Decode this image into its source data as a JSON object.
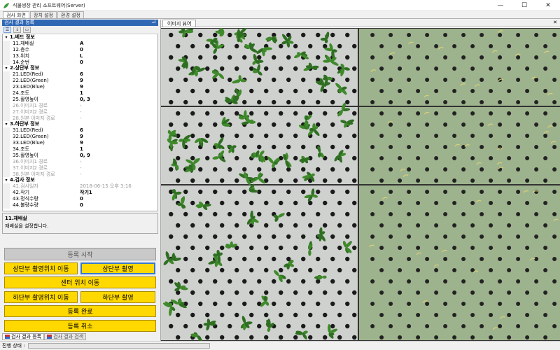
{
  "window": {
    "title": "식물생장 관리 소프트웨어(Server)"
  },
  "top_tabs": [
    "검사 화면",
    "장치 설정",
    "환경 설정"
  ],
  "left_panel": {
    "header": "검사 결과 등록",
    "categories": [
      {
        "title": "1.베드 정보",
        "rows": [
          {
            "name": "11.재배실",
            "value": "A"
          },
          {
            "name": "12.층수",
            "value": "0"
          },
          {
            "name": "13.위치",
            "value": "L"
          },
          {
            "name": "14.순번",
            "value": "0"
          }
        ]
      },
      {
        "title": "2.상단부 정보",
        "rows": [
          {
            "name": "21.LED(Red)",
            "value": "6"
          },
          {
            "name": "22.LED(Green)",
            "value": "9"
          },
          {
            "name": "23.LED(Blue)",
            "value": "9"
          },
          {
            "name": "24.조도",
            "value": "1"
          },
          {
            "name": "25.촬영높이",
            "value": "0, 3"
          },
          {
            "name": "26.이미지1 경로",
            "value": "-",
            "disabled": true
          },
          {
            "name": "27.이미지2 경로",
            "value": "-",
            "disabled": true
          },
          {
            "name": "28.원본 이미지 경로",
            "value": "-",
            "disabled": true
          }
        ]
      },
      {
        "title": "3.하단부 정보",
        "rows": [
          {
            "name": "31.LED(Red)",
            "value": "6"
          },
          {
            "name": "32.LED(Green)",
            "value": "9"
          },
          {
            "name": "33.LED(Blue)",
            "value": "9"
          },
          {
            "name": "34.조도",
            "value": "1"
          },
          {
            "name": "35.촬영높이",
            "value": "0, 9"
          },
          {
            "name": "36.이미지1 경로",
            "value": "-",
            "disabled": true
          },
          {
            "name": "37.이미지2 경로",
            "value": "-",
            "disabled": true
          },
          {
            "name": "38.원본 이미지 경로",
            "value": "-",
            "disabled": true
          }
        ]
      },
      {
        "title": "4.검사 정보",
        "rows": [
          {
            "name": "41.검사일자",
            "value": "2018-06-15 오후 3:16",
            "disabled": true
          },
          {
            "name": "42.작기",
            "value": "작기1"
          },
          {
            "name": "43.정식수량",
            "value": "0"
          },
          {
            "name": "44.불량수량",
            "value": "0"
          }
        ]
      }
    ],
    "description": {
      "title": "11.재배실",
      "text": "재배실을 설정합니다."
    }
  },
  "buttons": {
    "register_start": "등록 시작",
    "upper_move": "상단부 촬영위치 이동",
    "upper_capture": "상단부 촬영",
    "center_move": "센터 위치 이동",
    "lower_move": "하단부 촬영위치 이동",
    "lower_capture": "하단부 촬영",
    "register_done": "등록 완료",
    "register_cancel": "등록 취소"
  },
  "bottom_tabs": [
    "검사 결과 등록",
    "검사 결과 검색"
  ],
  "status": {
    "label": "진행 상태 :"
  },
  "viewer": {
    "tab_label": "이미지 뷰어"
  },
  "colors": {
    "button_yellow": "#ffd800",
    "panel_header": "#2f67b5",
    "tray_green": "#9db38d",
    "plant_green": "#3f8a2a"
  }
}
